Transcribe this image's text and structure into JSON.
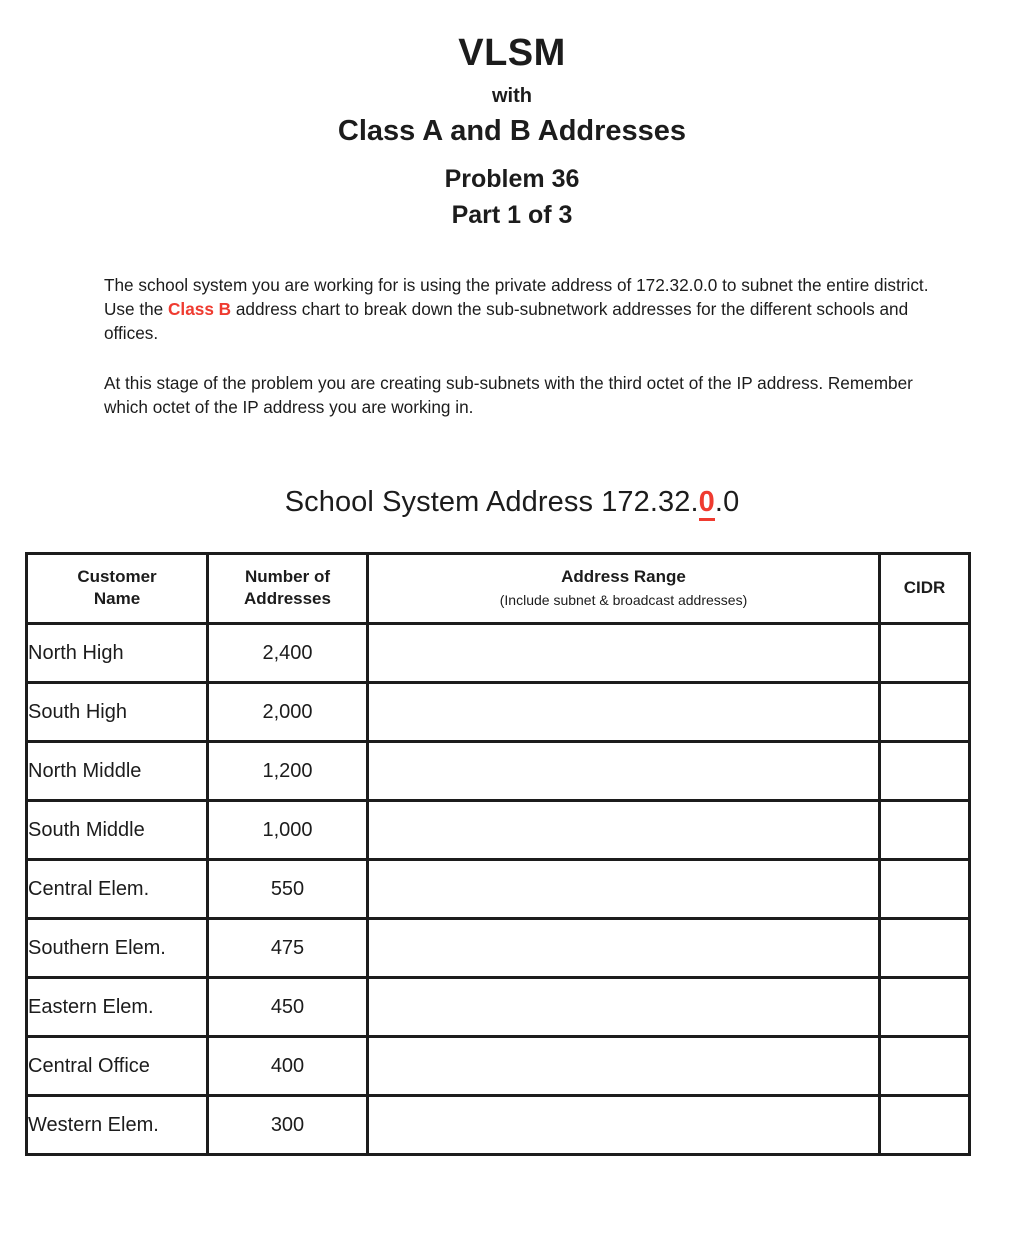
{
  "title": {
    "main": "VLSM",
    "with": "with",
    "subtitle": "Class A and B Addresses",
    "problem": "Problem 36",
    "part": "Part 1 of 3"
  },
  "paragraphs": {
    "p1_before": "The school system you are working for is using the private address of 172.32.0.0 to subnet the entire district.  Use the ",
    "p1_highlight": "Class B",
    "p1_after": " address chart to break down the sub-subnetwork addresses for the different schools and offices.",
    "p2": "At this stage of the problem you are creating sub-subnets with the third octet of the IP address. Remember which octet of the IP address you are working in."
  },
  "address_line": {
    "label": "School System  Address ",
    "prefix": "172.32.",
    "octet_highlight": "0",
    "suffix": ".0"
  },
  "table": {
    "headers": {
      "customer_name": "Customer Name",
      "customer_name_l1": "Customer",
      "customer_name_l2": "Name",
      "number_of_addresses": "Number of Addresses",
      "number_of_addresses_l1": "Number of",
      "number_of_addresses_l2": "Addresses",
      "address_range": "Address Range",
      "address_range_note": "(Include subnet & broadcast addresses)",
      "cidr": "CIDR"
    },
    "rows": [
      {
        "customer_name": "North High",
        "number_of_addresses": "2,400",
        "address_range": "",
        "cidr": ""
      },
      {
        "customer_name": "South High",
        "number_of_addresses": "2,000",
        "address_range": "",
        "cidr": ""
      },
      {
        "customer_name": "North Middle",
        "number_of_addresses": "1,200",
        "address_range": "",
        "cidr": ""
      },
      {
        "customer_name": "South Middle",
        "number_of_addresses": "1,000",
        "address_range": "",
        "cidr": ""
      },
      {
        "customer_name": "Central Elem.",
        "number_of_addresses": "550",
        "address_range": "",
        "cidr": ""
      },
      {
        "customer_name": "Southern Elem.",
        "number_of_addresses": "475",
        "address_range": "",
        "cidr": ""
      },
      {
        "customer_name": "Eastern  Elem.",
        "number_of_addresses": "450",
        "address_range": "",
        "cidr": ""
      },
      {
        "customer_name": "Central  Office",
        "number_of_addresses": "400",
        "address_range": "",
        "cidr": ""
      },
      {
        "customer_name": "Western  Elem.",
        "number_of_addresses": "300",
        "address_range": "",
        "cidr": ""
      }
    ]
  },
  "colors": {
    "accent_red": "#ef3b30",
    "text": "#1c1c1c",
    "border": "#1c1c1c",
    "background": "#ffffff"
  }
}
